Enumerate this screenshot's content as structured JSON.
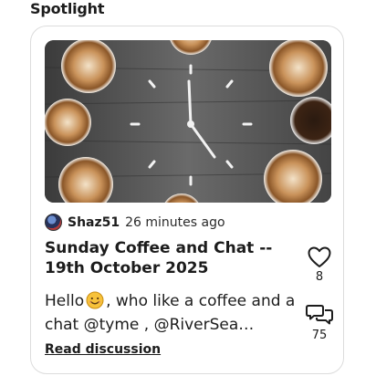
{
  "section": {
    "title": "Spotlight"
  },
  "post": {
    "author": "Shaz51",
    "time": "26 minutes ago",
    "title": "Sunday Coffee and Chat -- 19th October 2025",
    "excerpt_before_emoji": "Hello",
    "emoji": "smiling-face-emoji",
    "excerpt_after_emoji": ", who like a coffee  and a chat @tyme , @RiverSea…",
    "read_link": "Read discussion",
    "likes": "8",
    "comments": "75"
  },
  "icons": {
    "like": "heart-icon",
    "comment": "speech-bubbles-icon",
    "avatar": "avatar-image"
  },
  "colors": {
    "text": "#1c1c1c",
    "card_border": "#dcdcdc",
    "emoji_yellow": "#f7c23a"
  }
}
